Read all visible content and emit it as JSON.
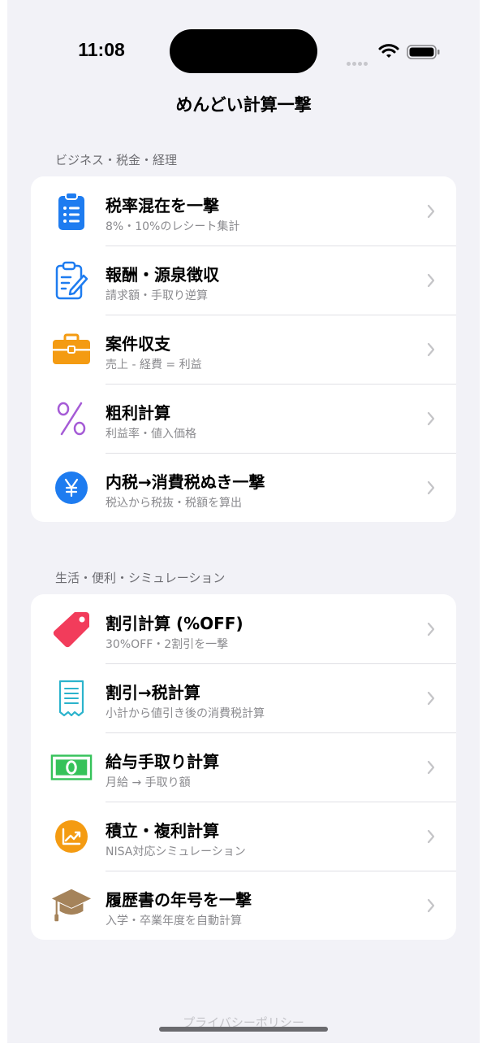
{
  "status_bar": {
    "time": "11:08"
  },
  "page": {
    "title": "めんどい計算一撃"
  },
  "sections": [
    {
      "header": "ビジネス・税金・経理",
      "items": [
        {
          "icon": "clipboard-list-icon",
          "title": "税率混在を一撃",
          "subtitle": "8%・10%のレシート集計"
        },
        {
          "icon": "clipboard-edit-icon",
          "title": "報酬・源泉徴収",
          "subtitle": "請求額・手取り逆算"
        },
        {
          "icon": "briefcase-icon",
          "title": "案件収支",
          "subtitle": "売上 - 経費 = 利益"
        },
        {
          "icon": "percent-icon",
          "title": "粗利計算",
          "subtitle": "利益率・値入価格"
        },
        {
          "icon": "yen-circle-icon",
          "title": "内税→消費税ぬき一撃",
          "subtitle": "税込から税抜・税額を算出"
        }
      ]
    },
    {
      "header": "生活・便利・シミュレーション",
      "items": [
        {
          "icon": "tag-icon",
          "title": "割引計算 (%OFF)",
          "subtitle": "30%OFF・2割引を一撃"
        },
        {
          "icon": "receipt-icon",
          "title": "割引→税計算",
          "subtitle": "小計から値引き後の消費税計算"
        },
        {
          "icon": "banknote-icon",
          "title": "給与手取り計算",
          "subtitle": "月給 → 手取り額"
        },
        {
          "icon": "chart-circle-icon",
          "title": "積立・複利計算",
          "subtitle": "NISA対応シミュレーション"
        },
        {
          "icon": "graduation-cap-icon",
          "title": "履歴書の年号を一撃",
          "subtitle": "入学・卒業年度を自動計算"
        }
      ]
    }
  ],
  "footer": {
    "privacy_link": "プライバシーポリシー"
  },
  "colors": {
    "background": "#f2f2f7",
    "blue": "#1e7cf0",
    "orange": "#f49b12",
    "purple": "#a55bd6",
    "red": "#f23c5b",
    "teal": "#2bb3cc",
    "green": "#36c25a",
    "brown": "#a5835a",
    "chevron": "#c4c4c7"
  }
}
